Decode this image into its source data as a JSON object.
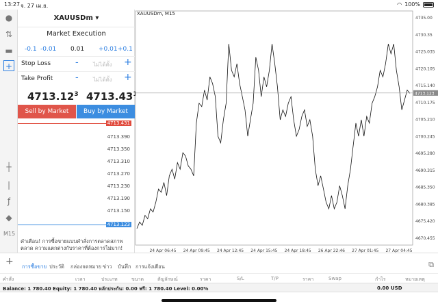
{
  "status": {
    "time": "13:27",
    "date": "จ. 27 เม.ย.",
    "battery": "100%"
  },
  "panel": {
    "symbol": "XAUUSDm",
    "execution": "Market Execution",
    "volumes": [
      "-0.1",
      "-0.01",
      "0.01",
      "+0.01",
      "+0.1"
    ],
    "stop_loss_label": "Stop Loss",
    "take_profit_label": "Take Profit",
    "placeholder": "ไม่ได้ตั้ง",
    "bid_main": "4713.12",
    "bid_sup": "3",
    "ask_main": "4713.43",
    "ask_sup": "1",
    "sell_label": "Sell by Market",
    "buy_label": "Buy by Market",
    "depth_prices": [
      "4713.431",
      "4713.390",
      "4713.350",
      "4713.310",
      "4713.270",
      "4713.230",
      "4713.190",
      "4713.150",
      "4713.123"
    ],
    "warning": "คำเตือน! การซื้อขายแบบคำสั่งการตลาดสภาพตลาด ความแตกต่างกับราคาที่ต้องการไม่มาก!"
  },
  "chart_data": {
    "type": "line",
    "title": "XAUUSDm, M15",
    "x": [
      "24 Apr 06:45",
      "24 Apr 09:45",
      "24 Apr 12:45",
      "24 Apr 15:45",
      "24 Apr 18:45",
      "26 Apr 22:46",
      "27 Apr 01:45",
      "27 Apr 04:45"
    ],
    "y_ticks": [
      "4735.00",
      "4730.35",
      "4725.035",
      "4720.105",
      "4715.140",
      "4710.175",
      "4705.210",
      "4700.245",
      "4695.280",
      "4690.315",
      "4685.350",
      "4680.385",
      "4675.420",
      "4670.455"
    ],
    "current_price": "4713.123",
    "ylim": [
      4667,
      4738
    ],
    "values": [
      4672,
      4674,
      4673,
      4676,
      4675,
      4678,
      4677,
      4680,
      4684,
      4683,
      4686,
      4682,
      4688,
      4690,
      4687,
      4692,
      4690,
      4695,
      4694,
      4691,
      4690,
      4688,
      4704,
      4710,
      4709,
      4714,
      4711,
      4718,
      4716,
      4712,
      4700,
      4698,
      4705,
      4710,
      4728,
      4720,
      4718,
      4722,
      4716,
      4712,
      4708,
      4700,
      4705,
      4710,
      4724,
      4720,
      4712,
      4718,
      4715,
      4720,
      4728,
      4722,
      4715,
      4705,
      4708,
      4706,
      4710,
      4712,
      4705,
      4700,
      4702,
      4706,
      4708,
      4703,
      4705,
      4700,
      4690,
      4685,
      4688,
      4684,
      4680,
      4678,
      4682,
      4678,
      4680,
      4685,
      4682,
      4678,
      4685,
      4690,
      4697,
      4704,
      4700,
      4705,
      4700,
      4706,
      4704,
      4710,
      4712,
      4715,
      4720,
      4718,
      4722,
      4728,
      4725,
      4728,
      4720,
      4715,
      4708,
      4711,
      4714,
      4713
    ]
  },
  "tabs": {
    "items": [
      "การซื้อขาย",
      "ประวัติ",
      "กล่องจดหมาย",
      "ข่าว",
      "บันทึก",
      "การแจ้งเตือน"
    ]
  },
  "columns": [
    "คำสั่ง",
    "เวลา",
    "ประเภท",
    "ขนาด",
    "สัญลักษณ์",
    "ราคา",
    "S/L",
    "T/P",
    "ราคา",
    "Swap",
    "กำไร",
    "หมายเหตุ"
  ],
  "balance": {
    "text": "Balance: 1 780.40 Equity: 1 780.40 หลักประกัน: 0.00 ฟรี: 1 780.40 Level: 0.00%",
    "profit": "0.00",
    "currency": "USD"
  },
  "colors": {
    "sell": "#e0554a",
    "buy": "#3c8de0",
    "accent": "#2a7de1"
  }
}
